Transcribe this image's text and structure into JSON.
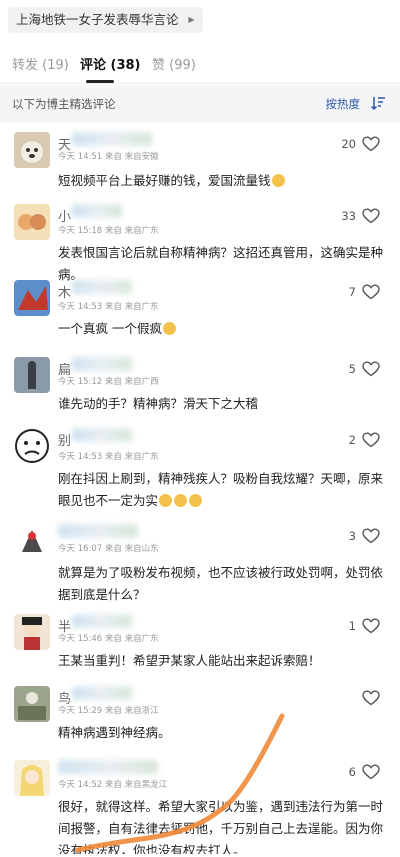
{
  "topic": {
    "title": "上海地铁一女子发表辱华言论"
  },
  "tabs": [
    {
      "label": "转发 (19)"
    },
    {
      "label": "评论 (38)"
    },
    {
      "label": "赞 (99)"
    }
  ],
  "filter": {
    "text": "以下为博主精选评论",
    "sort_label": "按热度"
  },
  "comments": [
    {
      "username": "天",
      "time": "今天 14:51 来自 来自安徽",
      "content": "短视频平台上最好赚的钱，爱国流量钱",
      "likes": "20"
    },
    {
      "username": "小",
      "time": "今天 15:18 来自 来自广东",
      "content": "发表恨国言论后就自称精神病？这招还真管用，这确实是种病。",
      "likes": "33"
    },
    {
      "username": "木",
      "time": "今天 14:53 来自 来自广东",
      "content": "一个真疯  一个假疯",
      "likes": "7"
    },
    {
      "username": "扁",
      "time": "今天 15:12 来自 来自广西",
      "content": "谁先动的手？精神病？滑天下之大稽",
      "likes": "5"
    },
    {
      "username": "别",
      "time": "今天 14:53 来自 来自广东",
      "content": "刚在抖因上刷到，精神残疾人？吸粉自我炫耀？天唧，原来眼见也不一定为实",
      "likes": "2"
    },
    {
      "username": "",
      "time": "今天 16:07 来自 来自山东",
      "content": "就算是为了吸粉发布视频，也不应该被行政处罚啊，处罚依据到底是什么？",
      "likes": "3"
    },
    {
      "username": "半",
      "time": "今天 15:46 来自 来自广东",
      "content": "王某当重判！希望尹某家人能站出来起诉索赔！",
      "likes": "1"
    },
    {
      "username": "鸟",
      "time": "今天 15:29 来自 来自浙江",
      "content": "精神病遇到神经病。",
      "likes": ""
    },
    {
      "username": "",
      "time": "今天 14:52 来自 来自黑龙江",
      "content": "很好，就得这样。希望大家引以为鉴，遇到违法行为第一时间报警，自有法律去惩罚他，千万别自己上去逞能。因为你没有执法权，你也没有权去打人。",
      "likes": "6"
    }
  ],
  "colors": {
    "accent": "#2b5aa8",
    "scribble": "#f08a3a",
    "filter_bg": "#f5f5f7"
  }
}
